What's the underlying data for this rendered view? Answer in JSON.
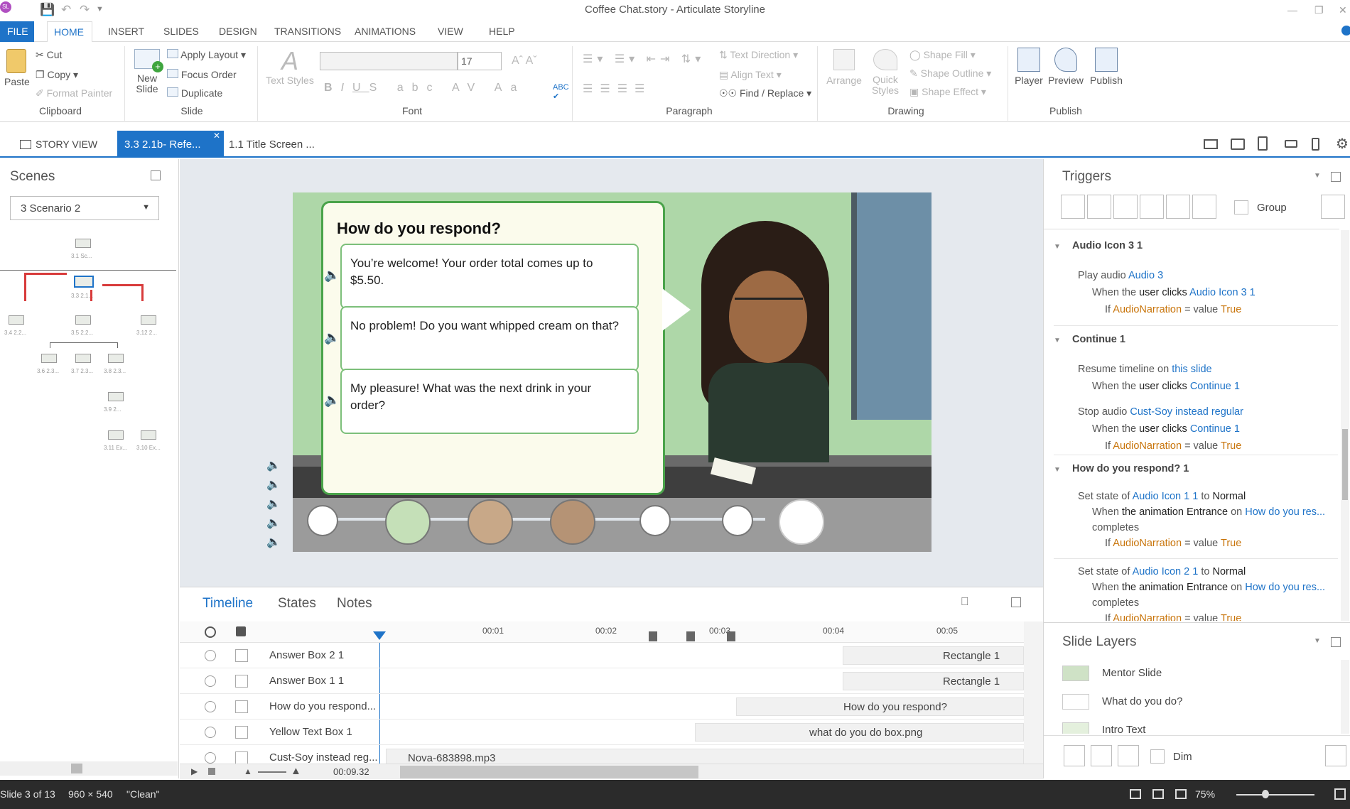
{
  "window": {
    "title": "Coffee Chat.story - Articulate Storyline",
    "app_badge": "SL"
  },
  "ribbon_tabs": [
    "FILE",
    "HOME",
    "INSERT",
    "SLIDES",
    "DESIGN",
    "TRANSITIONS",
    "ANIMATIONS",
    "VIEW",
    "HELP"
  ],
  "clipboard": {
    "paste": "Paste",
    "cut": "Cut",
    "copy": "Copy",
    "format_painter": "Format Painter",
    "group": "Clipboard"
  },
  "slide_group": {
    "new_slide": "New Slide",
    "apply_layout": "Apply Layout",
    "focus_order": "Focus Order",
    "duplicate": "Duplicate",
    "group": "Slide"
  },
  "font_group": {
    "text_styles": "Text Styles",
    "font_size": "17",
    "group": "Font"
  },
  "paragraph_group": {
    "text_direction": "Text Direction",
    "align_text": "Align Text",
    "find_replace": "Find / Replace",
    "group": "Paragraph"
  },
  "drawing_group": {
    "arrange": "Arrange",
    "quick_styles": "Quick Styles",
    "shape_fill": "Shape Fill",
    "shape_outline": "Shape Outline",
    "shape_effect": "Shape Effect",
    "group": "Drawing"
  },
  "publish_group": {
    "player": "Player",
    "preview": "Preview",
    "publish": "Publish",
    "group": "Publish"
  },
  "doc_tabs": {
    "story_view": "STORY VIEW",
    "active": "3.3 2.1b- Refe...",
    "other": "1.1 Title Screen ..."
  },
  "scenes": {
    "title": "Scenes",
    "selected": "3 Scenario 2",
    "labels": [
      "3.1 Sc...",
      "3.3 2.1...",
      "3.4 2.2...",
      "3.5 2.2...",
      "3.12 2...",
      "3.6 2.3...",
      "3.7 2.3...",
      "3.8 2.3...",
      "3.9 2...",
      "3.11 Ex...",
      "3.10 Ex..."
    ]
  },
  "slide": {
    "question": "How do you respond?",
    "answers": [
      "You’re welcome! Your order total comes up to $5.50.",
      "No problem! Do you want whipped cream on that?",
      "My pleasure! What was the next drink in your order?"
    ]
  },
  "timeline": {
    "tabs": [
      "Timeline",
      "States",
      "Notes"
    ],
    "ticks": [
      "00:01",
      "00:02",
      "00:03",
      "00:04",
      "00:05"
    ],
    "rows": [
      {
        "name": "Answer Box 2 1",
        "bar": "Rectangle 1"
      },
      {
        "name": "Answer Box 1 1",
        "bar": "Rectangle 1"
      },
      {
        "name": "How do you respond...",
        "bar": "How do you respond?"
      },
      {
        "name": "Yellow Text Box 1",
        "bar": "what do you do box.png"
      },
      {
        "name": "Cust-Soy instead reg...",
        "bar": "Nova-683898.mp3"
      }
    ],
    "current_time": "00:09.32"
  },
  "triggers": {
    "title": "Triggers",
    "group_label": "Group",
    "sections": [
      {
        "header": "Audio Icon 3 1"
      },
      {
        "header": "Continue 1"
      },
      {
        "header": "How do you respond? 1"
      }
    ],
    "t1_action": "Play audio",
    "t1_target": "Audio 3",
    "t1_when": "When the",
    "t1_user": "user clicks",
    "t1_obj": "Audio Icon 3 1",
    "if": "If",
    "var": "AudioNarration",
    "eq": "= value",
    "true": "True",
    "t2_action": "Resume timeline on",
    "t2_target": "this slide",
    "t2_obj": "Continue 1",
    "t3_action": "Stop audio",
    "t3_target": "Cust-Soy instead regular",
    "t4_action": "Set state of",
    "t4_obj": "Audio Icon 1 1",
    "to": "to",
    "normal": "Normal",
    "anim_when": "When",
    "anim": "the animation Entrance",
    "on": "on",
    "anim_obj": "How do you res...",
    "completes": "completes",
    "t5_obj": "Audio Icon 2 1"
  },
  "layers": {
    "title": "Slide Layers",
    "items": [
      "Mentor Slide",
      "What do you do?",
      "Intro Text"
    ],
    "dim": "Dim"
  },
  "status": {
    "slide": "Slide 3 of 13",
    "size": "960 × 540",
    "theme": "\"Clean\"",
    "zoom": "75%"
  }
}
